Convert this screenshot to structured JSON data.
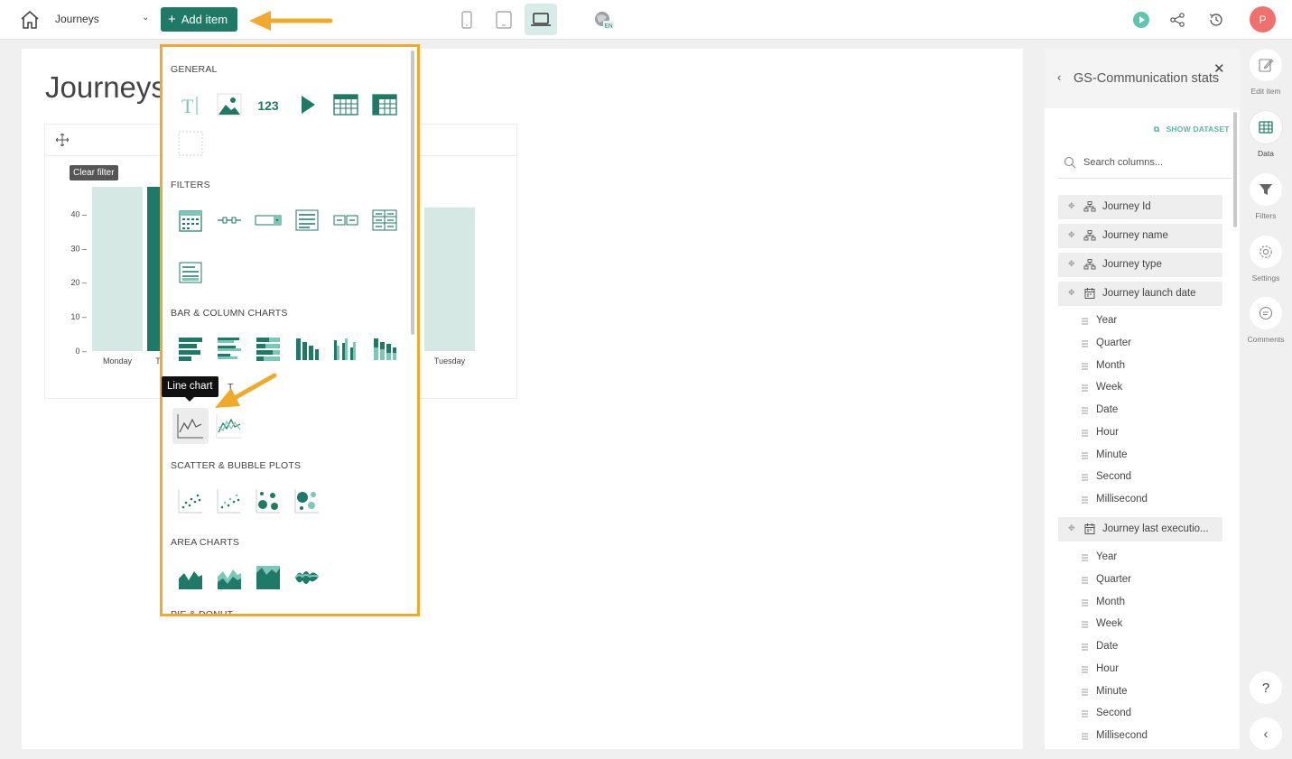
{
  "topbar": {
    "dashboard_name": "Journeys",
    "add_item_label": "Add item",
    "language": "EN",
    "avatar_initial": "P"
  },
  "canvas": {
    "title": "Journeys",
    "clear_filter": "Clear filter"
  },
  "chart_data": {
    "type": "bar",
    "categories": [
      "Monday",
      "T",
      "",
      "Tuesday"
    ],
    "values": [
      48,
      48,
      0,
      42
    ],
    "yticks": [
      0,
      10,
      20,
      30,
      40
    ],
    "ylim": [
      0,
      48
    ],
    "colors": [
      "#d5e8e4",
      "#1e7a66",
      "#d5e8e4",
      "#d5e8e4"
    ]
  },
  "picker": {
    "sections": {
      "general": "GENERAL",
      "filters": "FILTERS",
      "bar": "BAR & COLUMN CHARTS",
      "scatter": "SCATTER & BUBBLE PLOTS",
      "area": "AREA CHARTS",
      "pie": "PIE & DONUT"
    },
    "general_number": "123",
    "general_text": "T",
    "tooltip": "Line chart",
    "line_section_peek": "T"
  },
  "rpanel": {
    "title": "GS-Communication stats",
    "show_dataset": "SHOW DATASET",
    "search_placeholder": "Search columns...",
    "columns": [
      {
        "label": "Journey Id",
        "icon": "hierarchy-icon"
      },
      {
        "label": "Journey name",
        "icon": "hierarchy-icon"
      },
      {
        "label": "Journey type",
        "icon": "hierarchy-icon"
      },
      {
        "label": "Journey launch date",
        "icon": "calendar-icon"
      },
      {
        "label": "Journey last executio...",
        "icon": "calendar-icon"
      }
    ],
    "date_parts_1": [
      "Year",
      "Quarter",
      "Month",
      "Week",
      "Date",
      "Hour",
      "Minute",
      "Second",
      "Millisecond"
    ],
    "date_parts_2": [
      "Year",
      "Quarter",
      "Month",
      "Week",
      "Date",
      "Hour",
      "Minute",
      "Second",
      "Millisecond"
    ]
  },
  "sidebar": {
    "edit_item": "Edit item",
    "data": "Data",
    "filters": "Filters",
    "settings": "Settings",
    "comments": "Comments",
    "help": "?"
  },
  "colors": {
    "accent": "#1e7a66",
    "accent_light": "#d5e8e4",
    "highlight_border": "#f0a92a",
    "avatar": "#f0716b"
  }
}
